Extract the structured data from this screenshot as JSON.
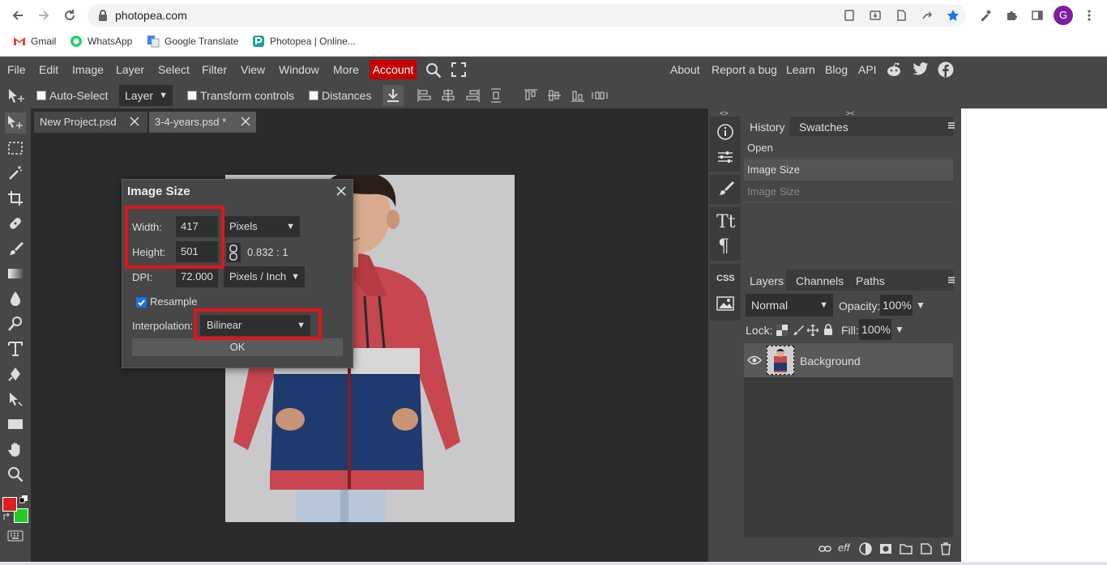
{
  "browser": {
    "url": "photopea.com",
    "bookmarks": [
      "Gmail",
      "WhatsApp",
      "Google Translate",
      "Photopea | Online..."
    ],
    "profile_letter": "G"
  },
  "menu": {
    "items": [
      "File",
      "Edit",
      "Image",
      "Layer",
      "Select",
      "Filter",
      "View",
      "Window",
      "More"
    ],
    "account": "Account",
    "right_items": [
      "About",
      "Report a bug",
      "Learn",
      "Blog",
      "API"
    ]
  },
  "options": {
    "auto_select": "Auto-Select",
    "layer_select": "Layer",
    "transform_controls": "Transform controls",
    "distances": "Distances"
  },
  "tabs": [
    {
      "label": "New Project.psd"
    },
    {
      "label": "3-4-years.psd *"
    }
  ],
  "dialog": {
    "title": "Image Size",
    "width_label": "Width:",
    "width_value": "417",
    "height_label": "Height:",
    "height_value": "501",
    "unit": "Pixels",
    "ratio": "0.832 : 1",
    "dpi_label": "DPI:",
    "dpi_value": "72.000",
    "dpi_unit": "Pixels / Inch",
    "resample_label": "Resample",
    "resample_checked": true,
    "interpolation_label": "Interpolation:",
    "interpolation_value": "Bilinear",
    "ok_label": "OK"
  },
  "history_panel": {
    "tabs": [
      "History",
      "Swatches"
    ],
    "items": [
      "Open",
      "Image Size",
      "Image Size"
    ]
  },
  "layers_panel": {
    "tabs": [
      "Layers",
      "Channels",
      "Paths"
    ],
    "blend_mode": "Normal",
    "opacity_label": "Opacity:",
    "opacity_value": "100%",
    "lock_label": "Lock:",
    "fill_label": "Fill:",
    "fill_value": "100%",
    "layers": [
      {
        "name": "Background"
      }
    ]
  },
  "colors": {
    "accent_red": "#c50000",
    "highlight_red": "#e0151b",
    "foreground": "#e02020",
    "background": "#22cc22"
  }
}
